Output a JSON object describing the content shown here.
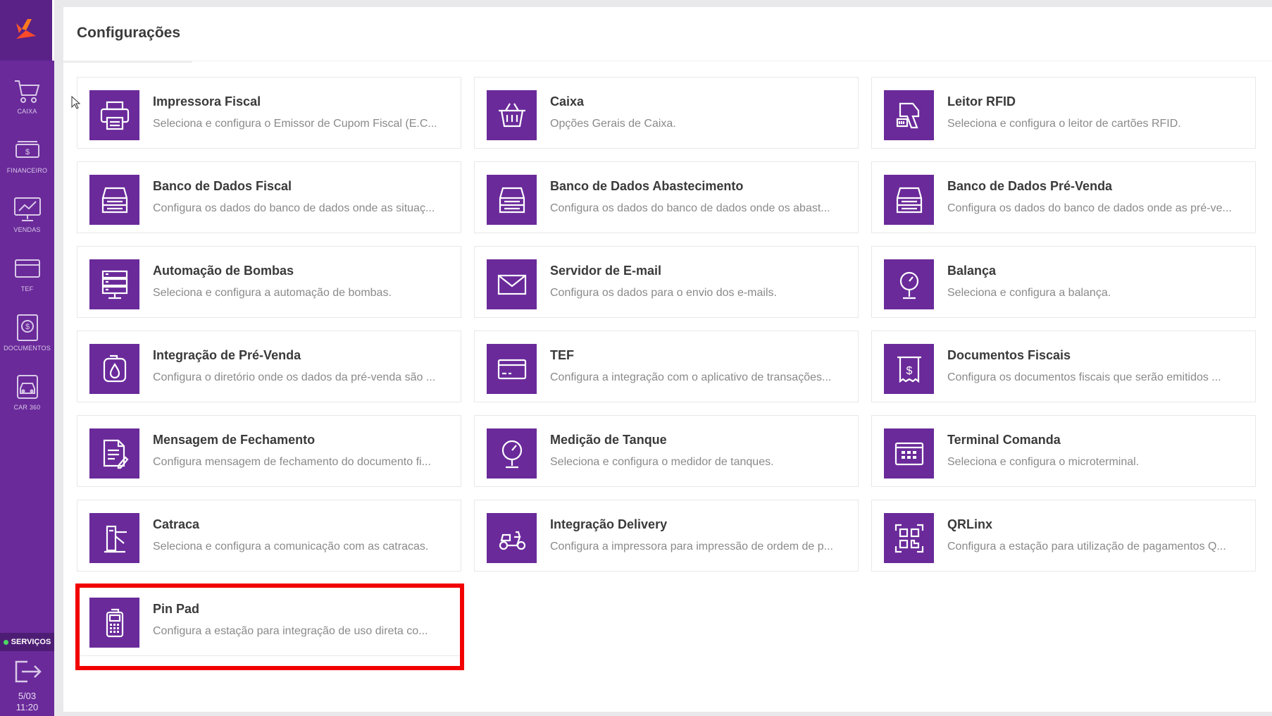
{
  "sidebar": {
    "items": [
      {
        "label": "CAIXA",
        "icon": "cart-icon"
      },
      {
        "label": "FINANCEIRO",
        "icon": "money-icon"
      },
      {
        "label": "VENDAS",
        "icon": "monitor-chart-icon"
      },
      {
        "label": "TEF",
        "icon": "card-icon"
      },
      {
        "label": "DOCUMENTOS",
        "icon": "document-dollar-icon"
      },
      {
        "label": "CAR 360",
        "icon": "car-icon"
      }
    ],
    "services_label": "SERVIÇOS",
    "date": "5/03",
    "time": "11:20"
  },
  "page": {
    "title": "Configurações"
  },
  "cards": [
    {
      "title": "Impressora Fiscal",
      "desc": "Seleciona e configura o Emissor de Cupom Fiscal (E.C...",
      "icon": "printer-icon"
    },
    {
      "title": "Caixa",
      "desc": "Opções Gerais de Caixa.",
      "icon": "basket-icon"
    },
    {
      "title": "Leitor RFID",
      "desc": "Seleciona e configura o leitor de cartões RFID.",
      "icon": "rfid-reader-icon"
    },
    {
      "title": "Banco de Dados Fiscal",
      "desc": "Configura os dados do banco de dados onde as situaç...",
      "icon": "database-server-icon"
    },
    {
      "title": "Banco de Dados Abastecimento",
      "desc": "Configura os dados do banco de dados onde os abast...",
      "icon": "database-server-icon"
    },
    {
      "title": "Banco de Dados Pré-Venda",
      "desc": "Configura os dados do banco de dados onde as pré-ve...",
      "icon": "database-server-icon"
    },
    {
      "title": "Automação de Bombas",
      "desc": "Seleciona e configura a automação de bombas.",
      "icon": "server-rack-icon"
    },
    {
      "title": "Servidor de E-mail",
      "desc": "Configura os dados para o envio dos e-mails.",
      "icon": "envelope-icon"
    },
    {
      "title": "Balança",
      "desc": "Seleciona e configura a balança.",
      "icon": "scale-icon"
    },
    {
      "title": "Integração de Pré-Venda",
      "desc": "Configura o diretório onde os dados da pré-venda são ...",
      "icon": "fuel-drop-icon"
    },
    {
      "title": "TEF",
      "desc": "Configura a integração com o aplicativo de transações...",
      "icon": "credit-card-icon"
    },
    {
      "title": "Documentos Fiscais",
      "desc": "Configura os documentos fiscais que serão emitidos ...",
      "icon": "receipt-dollar-icon"
    },
    {
      "title": "Mensagem de Fechamento",
      "desc": "Configura mensagem de fechamento do documento fi...",
      "icon": "document-edit-icon"
    },
    {
      "title": "Medição de Tanque",
      "desc": "Seleciona e configura o medidor de tanques.",
      "icon": "gauge-icon"
    },
    {
      "title": "Terminal Comanda",
      "desc": "Seleciona e configura o microterminal.",
      "icon": "keypad-terminal-icon"
    },
    {
      "title": "Catraca",
      "desc": "Seleciona e configura a comunicação com as catracas.",
      "icon": "turnstile-icon"
    },
    {
      "title": "Integração Delivery",
      "desc": "Configura a impressora para impressão de ordem de p...",
      "icon": "delivery-scooter-icon"
    },
    {
      "title": "QRLinx",
      "desc": "Configura a estação para utilização de pagamentos Q...",
      "icon": "qr-code-icon"
    },
    {
      "title": "Pin Pad",
      "desc": "Configura a estação para integração de uso direta co...",
      "icon": "pinpad-icon"
    }
  ],
  "colors": {
    "accent": "#6a2a9a",
    "highlight": "#f20000"
  }
}
